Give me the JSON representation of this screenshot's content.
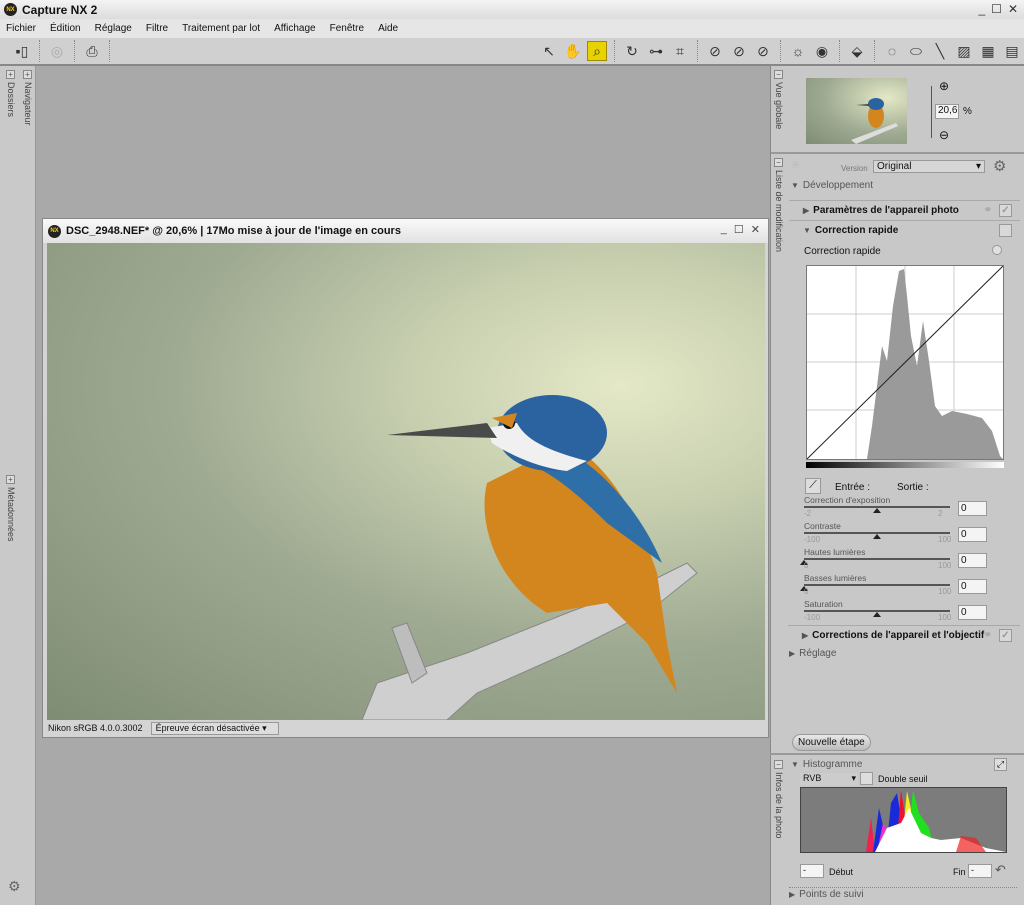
{
  "app": {
    "title": "Capture NX 2",
    "logo": "NX"
  },
  "menu": [
    "Fichier",
    "Édition",
    "Réglage",
    "Filtre",
    "Traitement par lot",
    "Affichage",
    "Fenêtre",
    "Aide"
  ],
  "left_tabs": {
    "folders": "Dossiers",
    "navigator": "Navigateur",
    "metadata": "Métadonnées"
  },
  "image_window": {
    "title": "DSC_2948.NEF* @ 20,6% | 17Mo mise à jour de l'image en cours",
    "profile": "Nikon sRGB 4.0.0.3002",
    "proof": "Épreuve écran désactivée"
  },
  "overview": {
    "tab": "Vue globale",
    "zoom": "20,6",
    "unit": "%"
  },
  "edit_list": {
    "tab": "Liste de modification",
    "version_label": "Version",
    "version_value": "Original",
    "development": "Développement",
    "camera_settings": "Paramètres de l'appareil photo",
    "quick_fix": "Correction rapide",
    "quick_fix_sub": "Correction rapide",
    "input": "Entrée :",
    "output": "Sortie :",
    "sliders": [
      {
        "label": "Correction d'exposition",
        "min": "-2",
        "max": "2",
        "value": "0",
        "pos": 0.5
      },
      {
        "label": "Contraste",
        "min": "-100",
        "max": "100",
        "value": "0",
        "pos": 0.5
      },
      {
        "label": "Hautes lumières",
        "min": "0",
        "max": "100",
        "value": "0",
        "pos": 0
      },
      {
        "label": "Basses lumières",
        "min": "0",
        "max": "100",
        "value": "0",
        "pos": 0
      },
      {
        "label": "Saturation",
        "min": "-100",
        "max": "100",
        "value": "0",
        "pos": 0.5
      }
    ],
    "lens_corrections": "Corrections de l'appareil et l'objectif",
    "adjust": "Réglage",
    "new_step": "Nouvelle étape"
  },
  "photo_info": {
    "tab": "Infos de la photo",
    "histogram": "Histogramme",
    "channel": "RVB",
    "double_threshold": "Double seuil",
    "start_label": "Début",
    "start_value": "-",
    "end_label": "Fin",
    "end_value": "-",
    "tracking_points": "Points de suivi"
  }
}
